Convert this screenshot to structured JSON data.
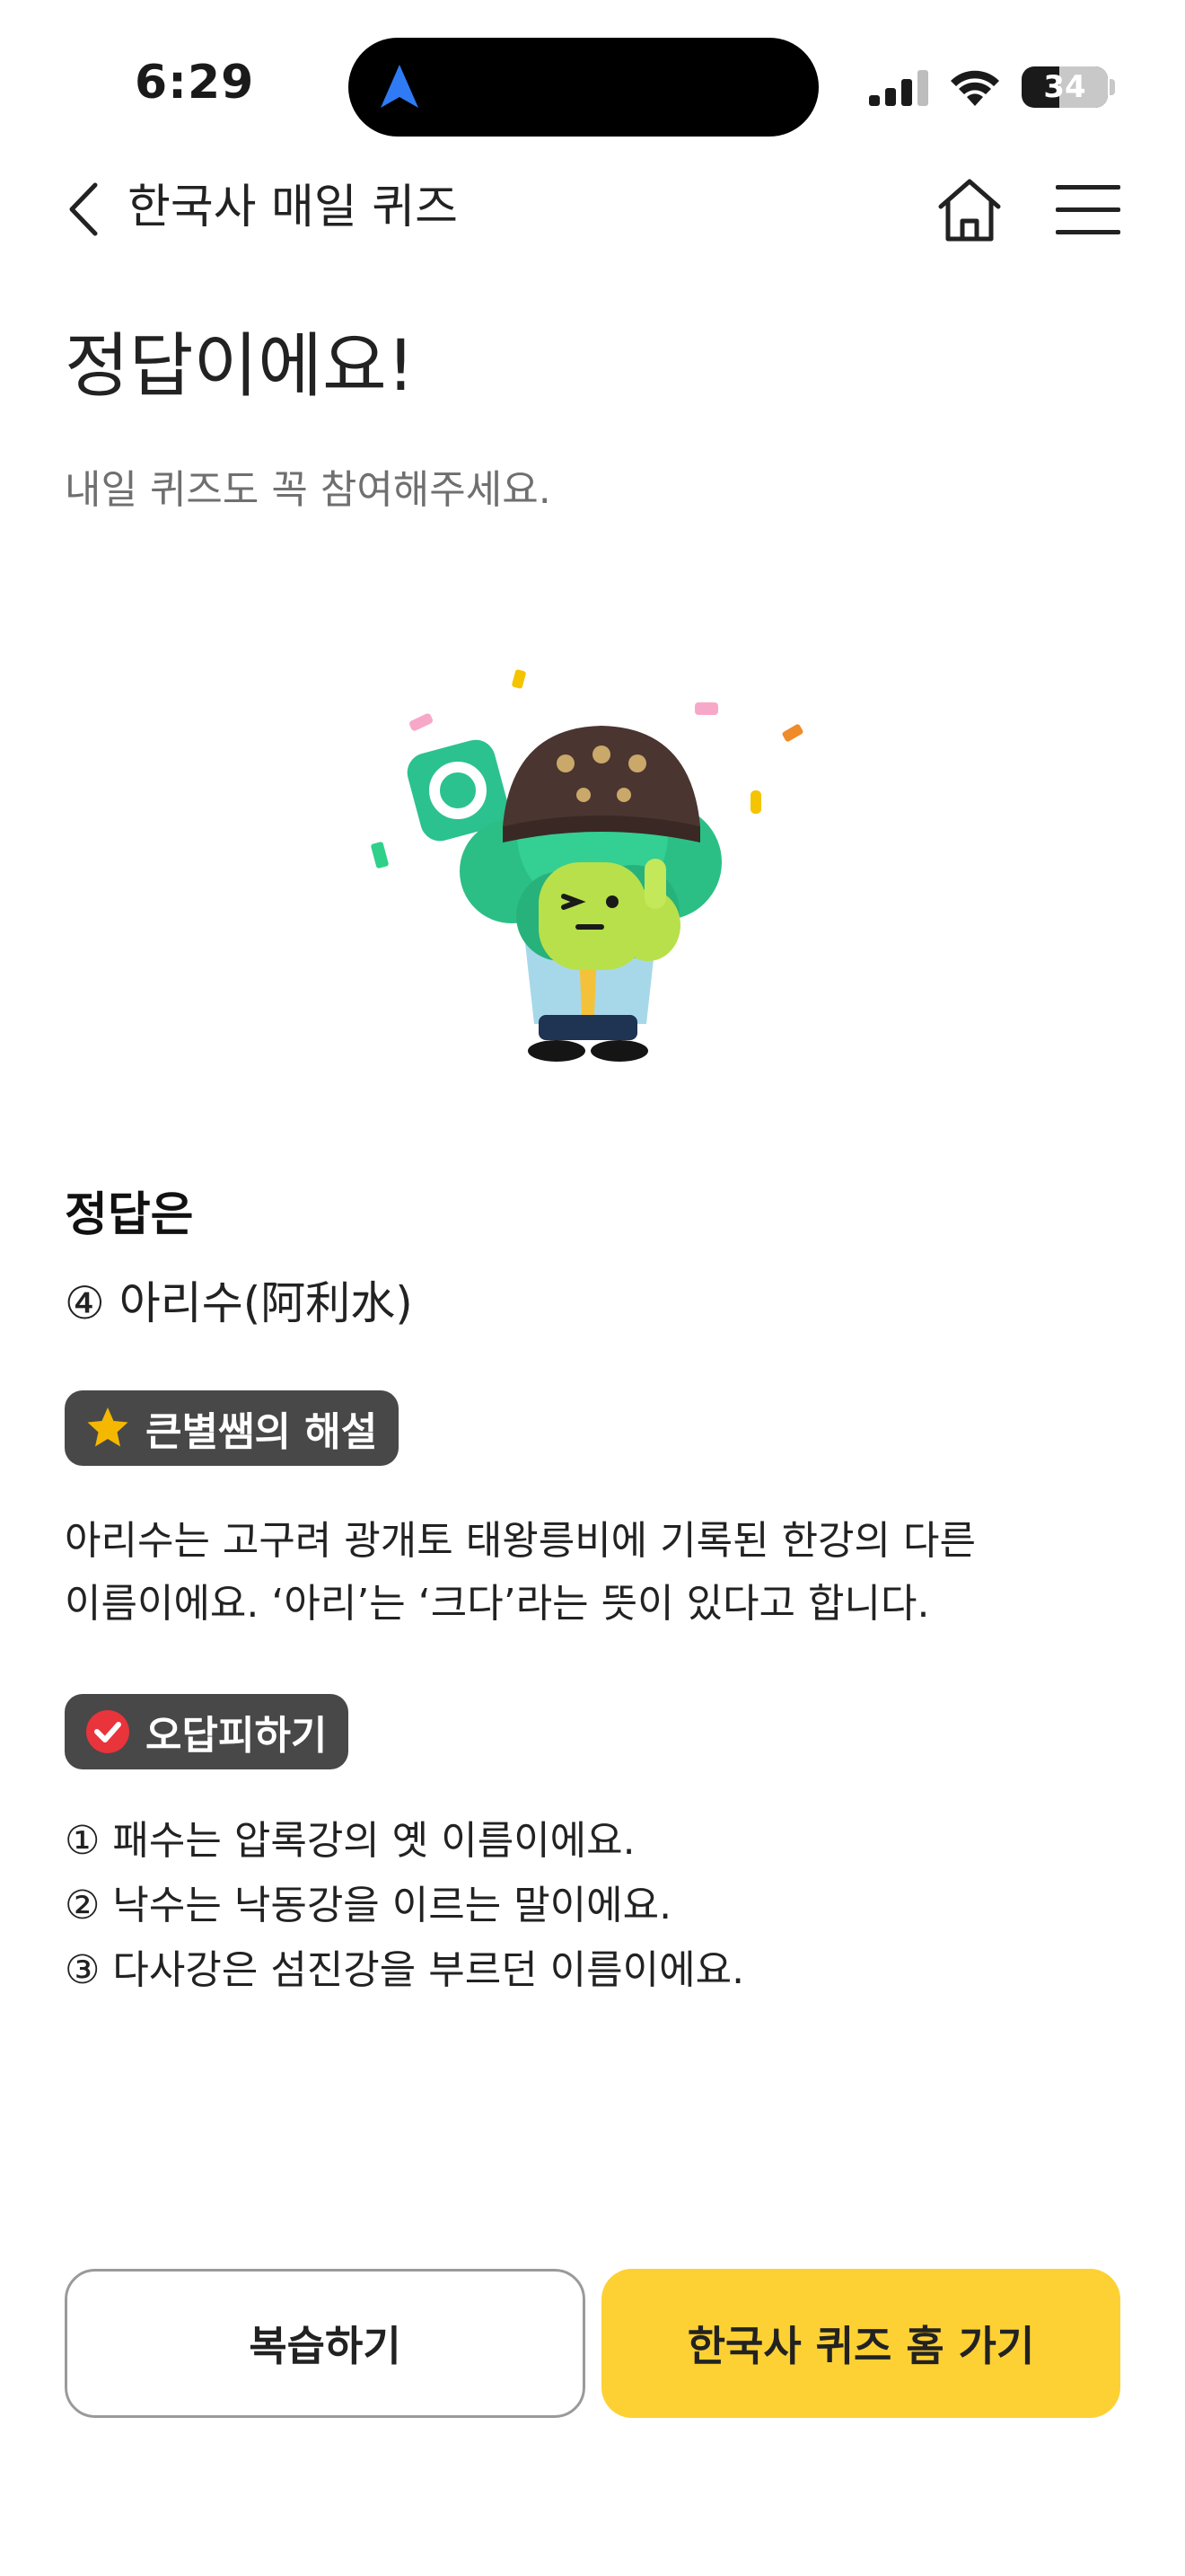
{
  "status": {
    "time": "6:29",
    "battery": "34"
  },
  "nav": {
    "title": "한국사 매일 퀴즈"
  },
  "result": {
    "headline": "정답이에요!",
    "subtitle": "내일 퀴즈도 꼭 참여해주세요."
  },
  "answer": {
    "label": "정답은",
    "value": "④ 아리수(阿利水)"
  },
  "explanation": {
    "tag": "큰별쌤의 해설",
    "lines": [
      "아리수는 고구려 광개토 태왕릉비에 기록된 한강의 다른",
      "이름이에요. ‘아리’는 ‘크다’라는 뜻이 있다고 합니다."
    ]
  },
  "wrong_answers": {
    "tag": "오답피하기",
    "items": [
      "① 패수는 압록강의 옛 이름이에요.",
      "② 낙수는 낙동강을 이르는 말이에요.",
      "③ 다사강은 섬진강을 부르던 이름이에요."
    ]
  },
  "buttons": {
    "review": "복습하기",
    "home": "한국사 퀴즈 홈 가기"
  },
  "colors": {
    "accent": "#fdd133",
    "tag_bg": "#484848",
    "check_red": "#e8343a",
    "star": "#f5b800"
  }
}
